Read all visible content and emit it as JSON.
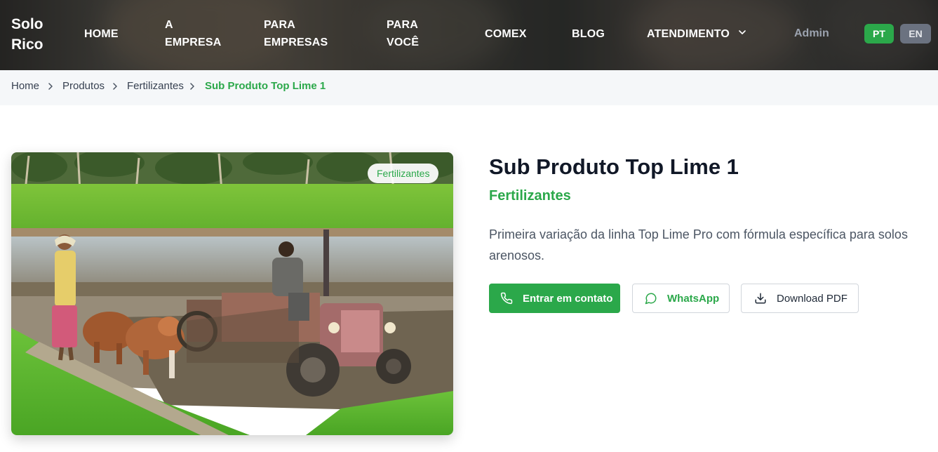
{
  "header": {
    "logo": "Solo Rico",
    "nav": [
      {
        "label": "HOME"
      },
      {
        "label": "A EMPRESA"
      },
      {
        "label": "PARA EMPRESAS"
      },
      {
        "label": "PARA VOCÊ"
      },
      {
        "label": "COMEX"
      },
      {
        "label": "BLOG"
      },
      {
        "label": "ATENDIMENTO",
        "icon": "chevron-down-icon"
      }
    ],
    "admin": "Admin",
    "languages": [
      {
        "label": "PT",
        "active": true,
        "color": "#2ba84a"
      },
      {
        "label": "EN",
        "active": false,
        "color": "#6b7280"
      }
    ]
  },
  "breadcrumb": {
    "items": [
      "Home",
      "Produtos",
      "Fertilizantes",
      "Sub Produto Top Lime 1"
    ],
    "separator_icon": "chevron-right-icon"
  },
  "product": {
    "image_badge": "Fertilizantes",
    "title": "Sub Produto Top Lime 1",
    "category": "Fertilizantes",
    "description": "Primeira variação da linha Top Lime Pro com fórmula específica para solos arenosos.",
    "buttons": {
      "contact": {
        "label": "Entrar em contato",
        "icon": "phone-icon"
      },
      "whatsapp": {
        "label": "WhatsApp",
        "icon": "chat-bubble-icon"
      },
      "pdf": {
        "label": "Download PDF",
        "icon": "download-icon"
      }
    }
  },
  "colors": {
    "accent": "#2ba84a",
    "title": "#111827",
    "text": "#4b5563"
  }
}
